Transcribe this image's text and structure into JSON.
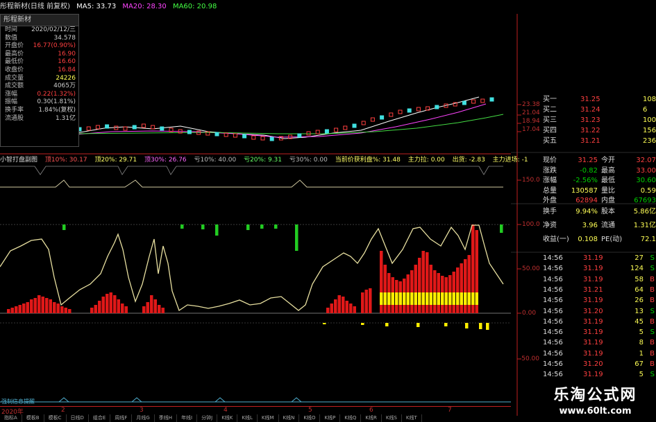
{
  "topbar": {
    "title": "彤程新材(日线 前复权)",
    "ma5": "MA5: 33.73",
    "ma20": "MA20: 28.30",
    "ma60": "MA60: 20.98"
  },
  "infobox": {
    "header": "彤程新材",
    "rows": [
      {
        "k": "时间",
        "v": "2020/02/12/三",
        "c": "#cccccc"
      },
      {
        "k": "数值",
        "v": "34.578",
        "c": "#cccccc"
      },
      {
        "k": "开盘价",
        "v": "16.77(0.90%)",
        "c": "#ff4040"
      },
      {
        "k": "最高价",
        "v": "16.90",
        "c": "#ff4040"
      },
      {
        "k": "最低价",
        "v": "16.60",
        "c": "#ff4040"
      },
      {
        "k": "收盘价",
        "v": "16.84",
        "c": "#ff4040"
      },
      {
        "k": "成交量",
        "v": "24226",
        "c": "#ffff55"
      },
      {
        "k": "成交额",
        "v": "4065万",
        "c": "#cccccc"
      },
      {
        "k": "涨幅",
        "v": "0.22(1.32%)",
        "c": "#ff4040"
      },
      {
        "k": "振幅",
        "v": "0.30(1.81%)",
        "c": "#cccccc"
      },
      {
        "k": "换手率",
        "v": "1.84%(复权)",
        "c": "#cccccc"
      },
      {
        "k": "流通股",
        "v": "1.31亿",
        "c": "#cccccc"
      }
    ]
  },
  "price_axis": [
    "23.38",
    "21.04",
    "18.94",
    "17.04"
  ],
  "indicator_axis": [
    "150.0",
    "100.0",
    "50.00",
    "0.00",
    "-50.00"
  ],
  "indicator_header": {
    "name": "小智打盘副图",
    "f1": "顶10%: 30.17",
    "f2": "顶20%: 29.71",
    "f3": "顶30%: 26.76",
    "f4": "亏10%: 40.00",
    "f5": "亏20%: 9.31",
    "f6": "亏30%: 0.00",
    "f7": "当前价获利盘%: 31.48",
    "f8": "主力拉: 0.00",
    "f9": "出货: -2.83",
    "f10": "主力进场: -1"
  },
  "orderbook": [
    {
      "label": "买一",
      "price": "31.25",
      "vol": "108"
    },
    {
      "label": "买二",
      "price": "31.24",
      "vol": "6"
    },
    {
      "label": "买三",
      "price": "31.23",
      "vol": "100"
    },
    {
      "label": "买四",
      "price": "31.22",
      "vol": "156"
    },
    {
      "label": "买五",
      "price": "31.21",
      "vol": "236"
    }
  ],
  "quote": [
    {
      "a": "现价",
      "av": "31.25",
      "ac": "#ff4040",
      "b": "今开",
      "bv": "32.07",
      "bc": "#ff4040"
    },
    {
      "a": "涨跌",
      "av": "-0.82",
      "ac": "#00d000",
      "b": "最高",
      "bv": "33.00",
      "bc": "#ff4040"
    },
    {
      "a": "涨幅",
      "av": "-2.56%",
      "ac": "#00d000",
      "b": "最低",
      "bv": "30.60",
      "bc": "#00d000"
    },
    {
      "a": "总量",
      "av": "130587",
      "ac": "#ffff55",
      "b": "量比",
      "bv": "0.59",
      "bc": "#ffff55"
    },
    {
      "a": "外盘",
      "av": "62894",
      "ac": "#ff4040",
      "b": "内盘",
      "bv": "67693",
      "bc": "#00d000"
    }
  ],
  "quote2": [
    {
      "a": "换手",
      "av": "9.94%",
      "ac": "#ffff55",
      "b": "股本",
      "bv": "5.86亿",
      "bc": "#ffff55"
    },
    {
      "a": "净资",
      "av": "3.96",
      "ac": "#ffff55",
      "b": "流通",
      "bv": "1.31亿",
      "bc": "#ffff55"
    },
    {
      "a": "收益(一)",
      "av": "0.108",
      "ac": "#ffff55",
      "b": "PE(动)",
      "bv": "72.1",
      "bc": "#ffff55"
    }
  ],
  "trades": [
    {
      "t": "14:56",
      "p": "31.19",
      "v": "27",
      "s": "S"
    },
    {
      "t": "14:56",
      "p": "31.19",
      "v": "124",
      "s": "S"
    },
    {
      "t": "14:56",
      "p": "31.19",
      "v": "58",
      "s": "B"
    },
    {
      "t": "14:56",
      "p": "31.21",
      "v": "64",
      "s": "B"
    },
    {
      "t": "14:56",
      "p": "31.19",
      "v": "26",
      "s": "B"
    },
    {
      "t": "14:56",
      "p": "31.20",
      "v": "13",
      "s": "S"
    },
    {
      "t": "14:56",
      "p": "31.19",
      "v": "45",
      "s": "B"
    },
    {
      "t": "14:56",
      "p": "31.19",
      "v": "5",
      "s": "S"
    },
    {
      "t": "14:56",
      "p": "31.19",
      "v": "8",
      "s": "B"
    },
    {
      "t": "14:56",
      "p": "31.19",
      "v": "1",
      "s": "B"
    },
    {
      "t": "14:56",
      "p": "31.20",
      "v": "67",
      "s": "B"
    },
    {
      "t": "14:56",
      "p": "31.19",
      "v": "5",
      "s": "S"
    }
  ],
  "bottom": {
    "year": "2020年",
    "months": [
      "2",
      "3",
      "4",
      "5",
      "6",
      "7"
    ],
    "lower_label": "强制信息提醒",
    "tabs": [
      "指标A",
      "模板B",
      "模板C",
      "日线D",
      "组合E",
      "周线F",
      "月线G",
      "季线H",
      "年线I",
      "分钟J",
      "K线K",
      "K线L",
      "K线M",
      "K线N",
      "K线O",
      "K线P",
      "K线Q",
      "K线R",
      "K线S",
      "K线T"
    ]
  },
  "watermark": {
    "line1": "乐淘公式网",
    "line2": "www.60lt.com"
  },
  "colors": {
    "up": "#ff4040",
    "down": "#00d000",
    "line": "#e8e0a0",
    "axis": "#c02020"
  }
}
